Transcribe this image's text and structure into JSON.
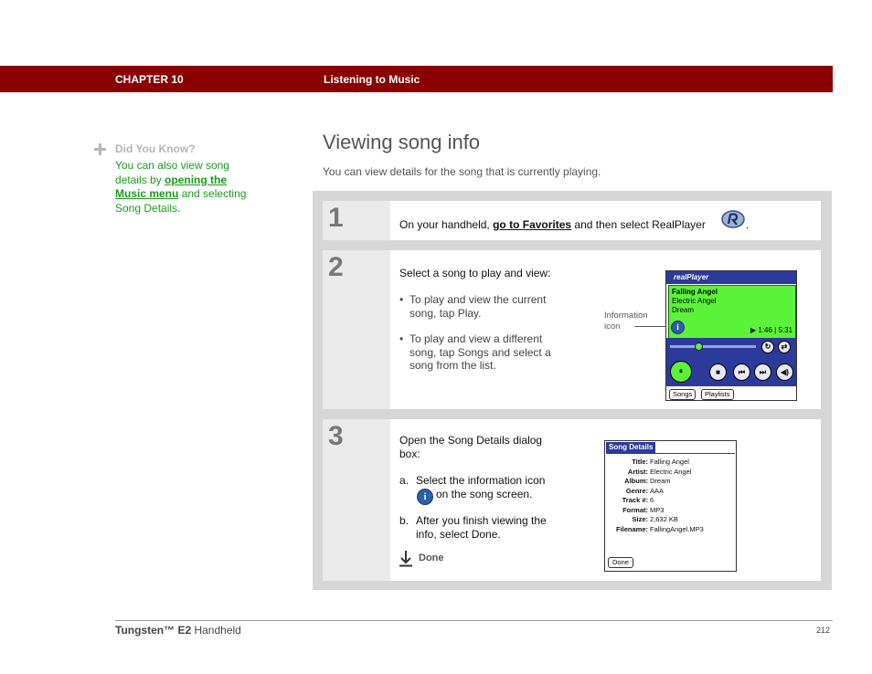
{
  "header": {
    "chapter": "CHAPTER 10",
    "section": "Listening to Music"
  },
  "tip": {
    "heading": "Did You Know?",
    "text_before": "You can also view song details by ",
    "link": "opening the Music menu",
    "text_after": " and selecting Song Details."
  },
  "page": {
    "title": "Viewing song info",
    "intro": "You can view details for the song that is currently playing."
  },
  "steps": [
    {
      "number": "1",
      "before": "On your handheld, ",
      "link": "go to Favorites",
      "after": " and then select RealPlayer",
      "end": "."
    },
    {
      "number": "2",
      "intro": "Select a song to play and view:",
      "bullets": [
        "To play and view the current song, tap Play.",
        "To play and view a different song, tap Songs and select a song from the list."
      ],
      "callout": "Information icon"
    },
    {
      "number": "3",
      "intro": "Open the Song Details dialog box:",
      "a_prefix": "a.",
      "a_text1": "Select the information icon",
      "a_text2": "on the song screen.",
      "b_prefix": "b.",
      "b_text": "After you finish viewing the info, select Done.",
      "done_label": "Done"
    }
  ],
  "realplayer_screen": {
    "brand": "realPlayer",
    "song": "Falling Angel",
    "artist": "Electric Angel",
    "album": "Dream",
    "time": "▶ 1:46 | 5:31",
    "tabs": [
      "Songs",
      "Playlists"
    ],
    "icon_info": "i",
    "icon_pause": "⏸",
    "icon_stop": "■",
    "icon_prev": "⏮",
    "icon_next": "⏭",
    "icon_volume": "◀)"
  },
  "song_details": {
    "title": "Song Details",
    "fields": [
      {
        "key": "Title:",
        "value": "Falling Angel"
      },
      {
        "key": "Artist:",
        "value": "Electric Angel"
      },
      {
        "key": "Album:",
        "value": "Dream"
      },
      {
        "key": "Genre:",
        "value": "AAA"
      },
      {
        "key": "Track #:",
        "value": "6"
      },
      {
        "key": "Format:",
        "value": "MP3"
      },
      {
        "key": "Size:",
        "value": "2,632 KB"
      },
      {
        "key": "Filename:",
        "value": "FallingAngel.MP3"
      }
    ],
    "done": "Done"
  },
  "footer": {
    "product_bold": "Tungsten™ E2",
    "product_rest": " Handheld",
    "page_number": "212"
  },
  "colors": {
    "header_bg": "#8b0000",
    "tip_green": "#1d9a1d",
    "palm_blue": "#2c3a9c",
    "screen_green": "#5cf23a"
  }
}
